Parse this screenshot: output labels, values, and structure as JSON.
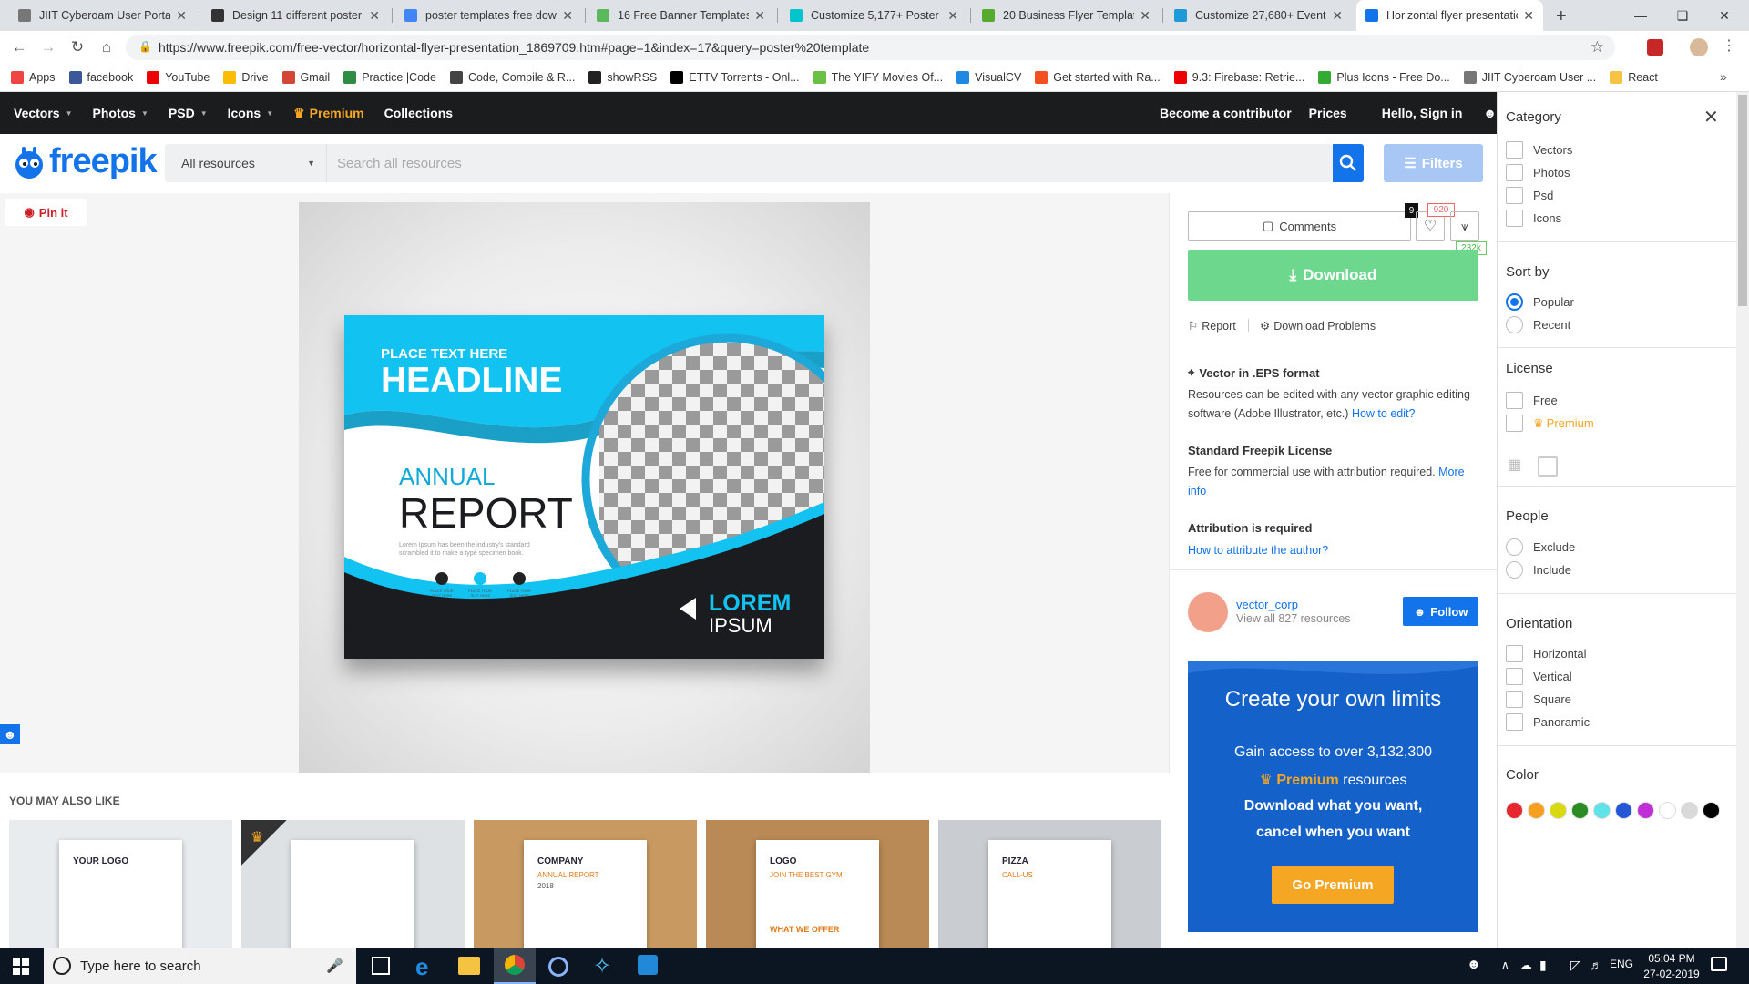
{
  "browser": {
    "tabs": [
      {
        "title": "JIIT Cyberoam User Portal",
        "color": "#777"
      },
      {
        "title": "Design 11 different poster o",
        "color": "#333"
      },
      {
        "title": "poster templates free down",
        "color": "#4285f4"
      },
      {
        "title": "16 Free Banner Templates &",
        "color": "#5cb85c"
      },
      {
        "title": "Customize 5,177+ Poster te",
        "color": "#00c4cc"
      },
      {
        "title": "20 Business Flyer Templates",
        "color": "#56ab2f"
      },
      {
        "title": "Customize 27,680+ Event Fl",
        "color": "#1e9bd7"
      },
      {
        "title": "Horizontal flyer presentatio",
        "color": "#1273eb"
      }
    ],
    "url": "https://www.freepik.com/free-vector/horizontal-flyer-presentation_1869709.htm#page=1&index=17&query=poster%20template",
    "bookmarks": [
      {
        "label": "Apps",
        "color": "#e44"
      },
      {
        "label": "facebook",
        "color": "#3b5998"
      },
      {
        "label": "YouTube",
        "color": "#e00"
      },
      {
        "label": "Drive",
        "color": "#fbbc05"
      },
      {
        "label": "Gmail",
        "color": "#d44638"
      },
      {
        "label": "Practice |Code",
        "color": "#2f8d46"
      },
      {
        "label": "Code, Compile & R...",
        "color": "#444"
      },
      {
        "label": "showRSS",
        "color": "#222"
      },
      {
        "label": "ETTV Torrents - Onl...",
        "color": "#000"
      },
      {
        "label": "The YIFY Movies Of...",
        "color": "#6ac045"
      },
      {
        "label": "VisualCV",
        "color": "#1e88e5"
      },
      {
        "label": "Get started with Ra...",
        "color": "#f25022"
      },
      {
        "label": "9.3: Firebase: Retrie...",
        "color": "#e00"
      },
      {
        "label": "Plus Icons - Free Do...",
        "color": "#3a3"
      },
      {
        "label": "JIIT Cyberoam User ...",
        "color": "#777"
      },
      {
        "label": "React",
        "color": "#f6c343"
      }
    ]
  },
  "site": {
    "nav": [
      "Vectors",
      "Photos",
      "PSD",
      "Icons",
      "Premium",
      "Collections"
    ],
    "right_nav": [
      "Become a contributor",
      "Prices",
      "Hello, Sign in"
    ],
    "logo": "freepik",
    "search_select": "All resources",
    "search_placeholder": "Search all resources",
    "filters_label": "Filters",
    "pin_label": "Pin it"
  },
  "flyer": {
    "place_text": "PLACE TEXT HERE",
    "headline": "HEADLINE",
    "annual": "ANNUAL",
    "report": "REPORT",
    "lorem1": "LOREM",
    "lorem2": "IPSUM",
    "body": "Lorem Ipsum has been the industry's standard scrambled it to make a type specimen book.",
    "icon_caption": "PLACE YOUR TEXT HERE"
  },
  "resource": {
    "comments_label": "Comments",
    "comments_count": "9",
    "likes_count": "920",
    "shares_count": "232k",
    "download_label": "Download",
    "report_label": "Report",
    "download_problems_label": "Download Problems",
    "format_title": "Vector in .EPS format",
    "format_desc": "Resources can be edited with any vector graphic editing software (Adobe Illustrator, etc.)",
    "how_to_edit": "How to edit?",
    "license_title": "Standard Freepik License",
    "license_desc": "Free for commercial use with attribution required.",
    "more_info": "More info",
    "attribution_title": "Attribution is required",
    "attribution_link": "How to attribute the author?",
    "author_name": "vector_corp",
    "author_resources": "View all 827 resources",
    "follow_label": "Follow"
  },
  "promo": {
    "title": "Create your own limits",
    "line1": "Gain access to over 3,132,300",
    "premium_word": "Premium",
    "resources_word": "resources",
    "line3": "Download what you want,",
    "line4": "cancel when you want",
    "button": "Go Premium"
  },
  "related": {
    "heading": "YOU MAY ALSO LIKE",
    "items": [
      {
        "caption": "YOUR LOGO",
        "bg": "#e9ecef"
      },
      {
        "caption": "",
        "bg": "#dde1e4"
      },
      {
        "caption": "COMPANY",
        "sub": "ANNUAL REPORT",
        "year": "2018",
        "bg": "#c89a62"
      },
      {
        "caption": "LOGO",
        "sub": "JOIN THE BEST GYM",
        "bottom": "WHAT WE OFFER",
        "bg": "#b98a56"
      },
      {
        "caption": "PIZZA",
        "sub": "CALL-US",
        "bg": "#c9ccd0"
      }
    ]
  },
  "filters": {
    "category_title": "Category",
    "category": [
      "Vectors",
      "Photos",
      "Psd",
      "Icons"
    ],
    "sort_title": "Sort by",
    "sort": [
      "Popular",
      "Recent"
    ],
    "license_title": "License",
    "license": [
      "Free",
      "Premium"
    ],
    "people_title": "People",
    "people": [
      "Exclude",
      "Include"
    ],
    "orientation_title": "Orientation",
    "orientation": [
      "Horizontal",
      "Vertical",
      "Square",
      "Panoramic"
    ],
    "color_title": "Color",
    "colors": [
      "#e8262f",
      "#f7a01d",
      "#d9d90f",
      "#2a8c22",
      "#5fe3e8",
      "#2457d6",
      "#c02fd6",
      "#ffffff",
      "#d9d9d9",
      "#000000"
    ]
  },
  "taskbar": {
    "search_placeholder": "Type here to search",
    "lang": "ENG",
    "time": "05:04 PM",
    "date": "27-02-2019"
  }
}
